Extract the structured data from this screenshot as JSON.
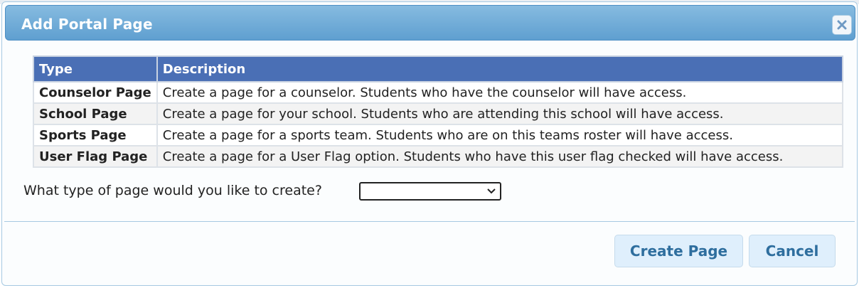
{
  "dialog": {
    "title": "Add Portal Page",
    "close_icon": "close-icon"
  },
  "table": {
    "headers": [
      "Type",
      "Description"
    ],
    "rows": [
      {
        "type": "Counselor Page",
        "description": "Create a page for a counselor. Students who have the counselor will have access."
      },
      {
        "type": "School Page",
        "description": "Create a page for your school. Students who are attending this school will have access."
      },
      {
        "type": "Sports Page",
        "description": "Create a page for a sports team. Students who are on this teams roster will have access."
      },
      {
        "type": "User Flag Page",
        "description": "Create a page for a User Flag option. Students who have this user flag checked will have access."
      }
    ]
  },
  "form": {
    "question": "What type of page would you like to create?",
    "select_value": ""
  },
  "buttons": {
    "create": "Create Page",
    "cancel": "Cancel"
  },
  "colors": {
    "header_bg": "#4a6fb5",
    "titlebar": "#6aa8d6",
    "button_text": "#2e6e9e"
  }
}
